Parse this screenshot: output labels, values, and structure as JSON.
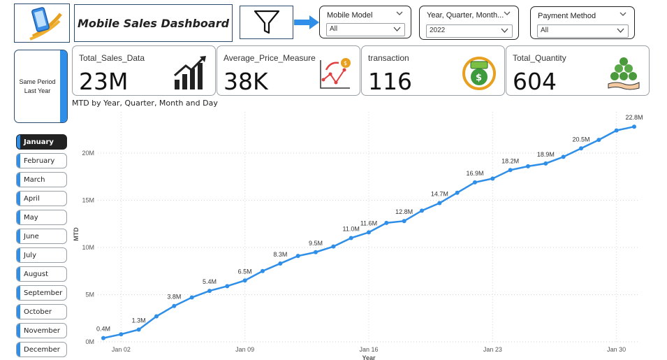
{
  "header": {
    "title": "Mobile Sales Dashboard",
    "logo_icon": "mobile-phone-icon",
    "filter_icon": "funnel-icon",
    "arrow_icon": "arrow-right-icon"
  },
  "slicers": [
    {
      "title": "Mobile Model",
      "value": "All"
    },
    {
      "title": "Year, Quarter, Month...",
      "value": "2022"
    },
    {
      "title": "Payment Method",
      "value": "All"
    }
  ],
  "same_period": {
    "label": "Same Period Last Year"
  },
  "kpis": [
    {
      "label": "Total_Sales_Data",
      "value": "23M",
      "icon": "bar-growth-icon"
    },
    {
      "label": "Average_Price_Measure",
      "value": "38K",
      "icon": "price-trend-icon"
    },
    {
      "label": "transaction",
      "value": "116",
      "icon": "money-cycle-icon"
    },
    {
      "label": "Total_Quantity",
      "value": "604",
      "icon": "money-hand-icon"
    }
  ],
  "months": [
    "January",
    "February",
    "March",
    "April",
    "May",
    "June",
    "July",
    "August",
    "September",
    "October",
    "November",
    "December"
  ],
  "selected_month": "January",
  "colors": {
    "accent": "#2e8ee8",
    "line": "#2e8ee8",
    "active_month": "#222222",
    "border": "#2c4a6e"
  },
  "chart_data": {
    "type": "line",
    "title": "MTD by Year, Quarter, Month and Day",
    "xlabel": "Year",
    "ylabel": "MTD",
    "x_ticks": [
      "Jan 02",
      "Jan 09",
      "Jan 16",
      "Jan 23",
      "Jan 30"
    ],
    "y_ticks": [
      "0M",
      "5M",
      "10M",
      "15M",
      "20M"
    ],
    "ylim": [
      0,
      24
    ],
    "grid": true,
    "x": [
      "Jan 01",
      "Jan 02",
      "Jan 03",
      "Jan 04",
      "Jan 05",
      "Jan 06",
      "Jan 07",
      "Jan 08",
      "Jan 09",
      "Jan 10",
      "Jan 11",
      "Jan 12",
      "Jan 13",
      "Jan 14",
      "Jan 15",
      "Jan 16",
      "Jan 17",
      "Jan 18",
      "Jan 19",
      "Jan 20",
      "Jan 21",
      "Jan 22",
      "Jan 23",
      "Jan 24",
      "Jan 25",
      "Jan 26",
      "Jan 27",
      "Jan 28",
      "Jan 29",
      "Jan 30",
      "Jan 31"
    ],
    "values": [
      0.4,
      0.8,
      1.3,
      2.7,
      3.8,
      4.7,
      5.4,
      5.9,
      6.5,
      7.5,
      8.3,
      9.1,
      9.5,
      10.1,
      11.0,
      11.6,
      12.6,
      12.8,
      13.9,
      14.7,
      15.8,
      16.9,
      17.3,
      18.2,
      18.6,
      18.9,
      19.6,
      20.5,
      21.4,
      22.4,
      22.8
    ],
    "data_labels": {
      "0": "0.4M",
      "2": "1.3M",
      "4": "3.8M",
      "6": "5.4M",
      "8": "6.5M",
      "10": "8.3M",
      "12": "9.5M",
      "14": "11.0M",
      "15": "11.6M",
      "17": "12.8M",
      "19": "14.7M",
      "21": "16.9M",
      "23": "18.2M",
      "25": "18.9M",
      "27": "20.5M",
      "30": "22.8M"
    }
  }
}
